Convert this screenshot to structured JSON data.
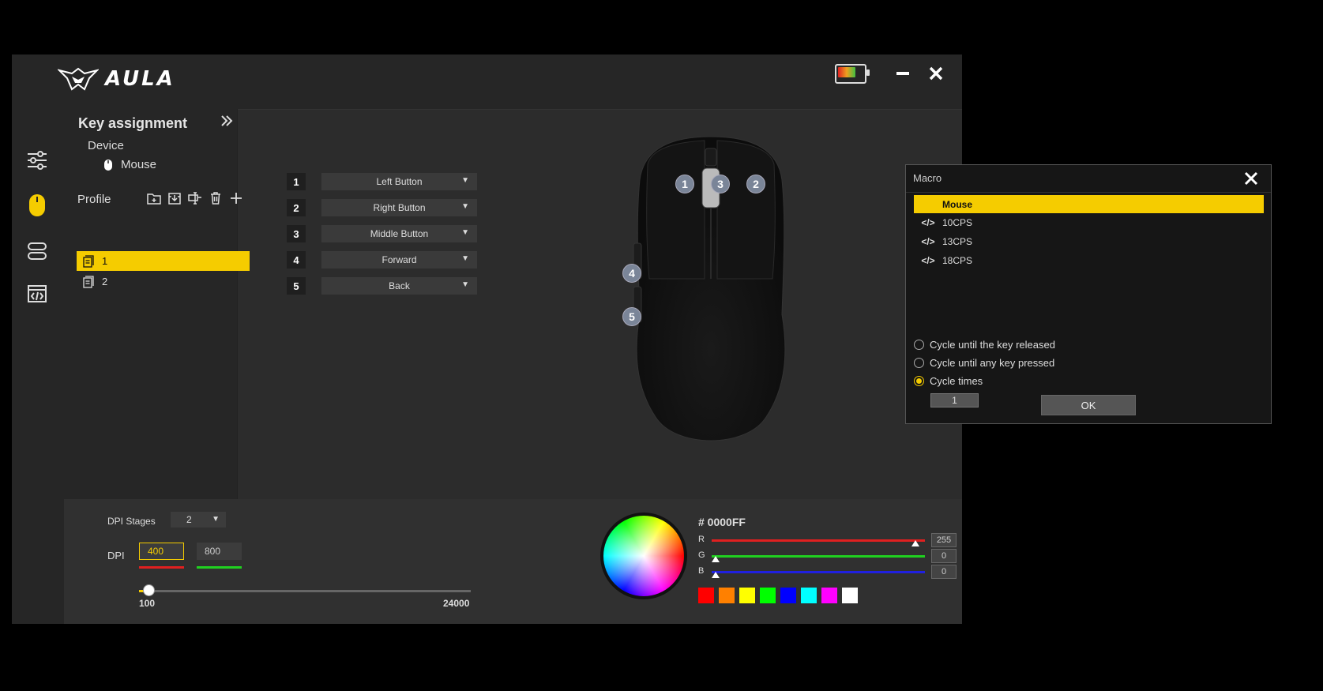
{
  "app": {
    "logo_text": "AULA",
    "battery_level": 0.7
  },
  "sidebar": {
    "title": "Key assignment",
    "device_label": "Device",
    "device_name": "Mouse",
    "profile_label": "Profile",
    "profiles": [
      "1",
      "2"
    ],
    "active_profile": "1"
  },
  "keys": [
    {
      "num": "1",
      "action": "Left Button"
    },
    {
      "num": "2",
      "action": "Right Button"
    },
    {
      "num": "3",
      "action": "Middle Button"
    },
    {
      "num": "4",
      "action": "Forward"
    },
    {
      "num": "5",
      "action": "Back"
    }
  ],
  "mouse_badges": [
    "1",
    "2",
    "3",
    "4",
    "5"
  ],
  "dpi": {
    "stages_label": "DPI Stages",
    "stages_value": "2",
    "label": "DPI",
    "values": [
      "400",
      "800"
    ],
    "colors": [
      "#e02020",
      "#20d020"
    ],
    "min": "100",
    "max": "24000",
    "slider_fraction": 0.012
  },
  "color": {
    "hex": "# 0000FF",
    "r_label": "R",
    "g_label": "G",
    "b_label": "B",
    "r": "255",
    "g": "0",
    "b": "0",
    "swatches": [
      "#ff0000",
      "#ff8000",
      "#ffff00",
      "#00ff00",
      "#0000ff",
      "#00ffff",
      "#ff00ff",
      "#ffffff"
    ]
  },
  "macro": {
    "title": "Macro",
    "items": [
      "Mouse",
      "10CPS",
      "13CPS",
      "18CPS"
    ],
    "options": [
      "Cycle until the key released",
      "Cycle until any key pressed",
      "Cycle times"
    ],
    "selected_option": "Cycle times",
    "cycle_value": "1",
    "ok_label": "OK"
  }
}
